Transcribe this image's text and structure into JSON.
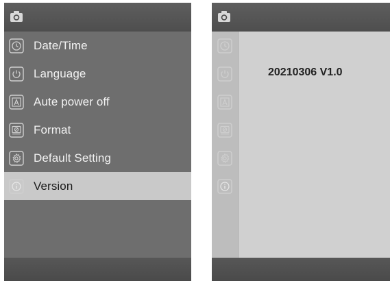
{
  "left_screen": {
    "menu_items": [
      {
        "label": "Date/Time",
        "icon": "clock-icon"
      },
      {
        "label": "Language",
        "icon": "power-icon"
      },
      {
        "label": "Aute power off",
        "icon": "auto-a-icon"
      },
      {
        "label": "Format",
        "icon": "format-drive-icon"
      },
      {
        "label": "Default Setting",
        "icon": "gear-icon"
      },
      {
        "label": "Version",
        "icon": "info-icon",
        "selected": true
      }
    ]
  },
  "right_screen": {
    "version_text": "20210306 V1.0",
    "sidebar_icons": [
      "clock-icon",
      "power-icon",
      "auto-a-icon",
      "format-drive-icon",
      "gear-icon",
      "info-icon"
    ]
  },
  "colors": {
    "topbar": "#575757",
    "menu_background": "#6e6e6e",
    "selected_row": "#c9c9c9",
    "icon_stroke": "#cfcfcf"
  }
}
